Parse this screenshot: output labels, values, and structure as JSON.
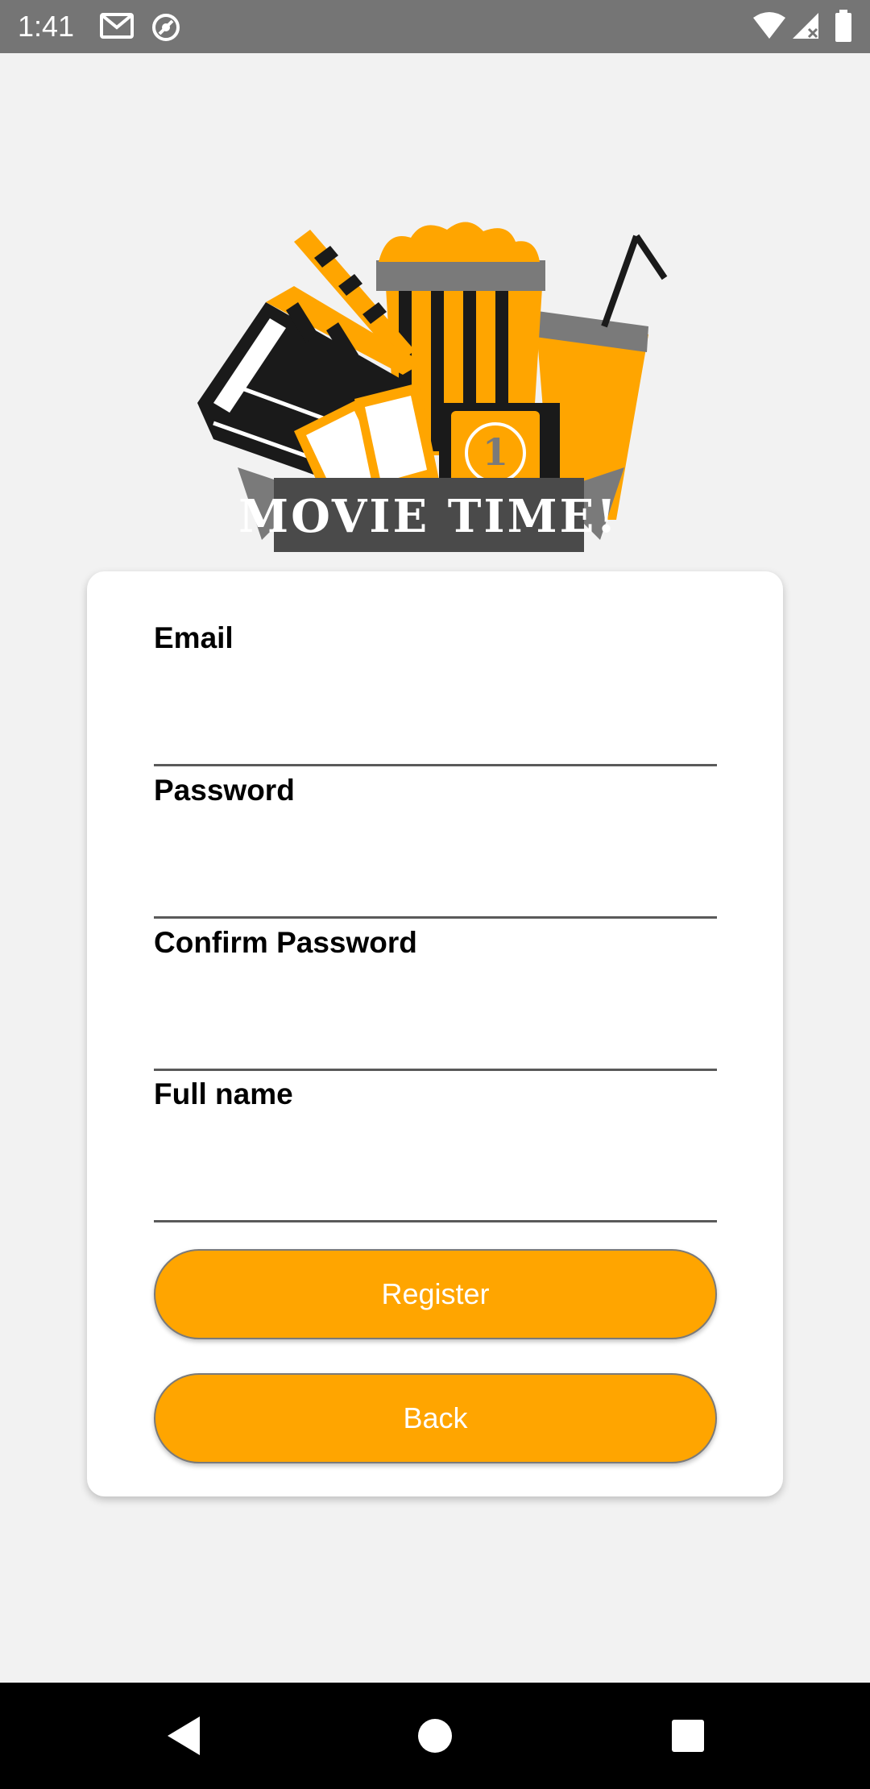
{
  "status_bar": {
    "time": "1:41",
    "left_icons": [
      "gmail-icon",
      "sync-icon"
    ],
    "right_icons": [
      "wifi-icon",
      "signal-icon",
      "battery-icon"
    ]
  },
  "logo": {
    "text": "MOVIE TIME!",
    "ticket_number": "1",
    "colors": {
      "orange": "#ffa500",
      "dark": "#1a1a1a",
      "gray": "#7a7a7a"
    }
  },
  "form": {
    "email": {
      "label": "Email",
      "value": ""
    },
    "password": {
      "label": "Password",
      "value": ""
    },
    "confirm_password": {
      "label": "Confirm Password",
      "value": ""
    },
    "full_name": {
      "label": "Full name",
      "value": ""
    }
  },
  "buttons": {
    "register": "Register",
    "back": "Back"
  },
  "colors": {
    "accent": "#ffa500",
    "background": "#f2f2f2",
    "card": "#ffffff",
    "status_bar": "#757575",
    "nav_bar": "#000000"
  },
  "nav_bar": {
    "items": [
      "back-triangle-icon",
      "home-circle-icon",
      "recents-square-icon"
    ]
  }
}
